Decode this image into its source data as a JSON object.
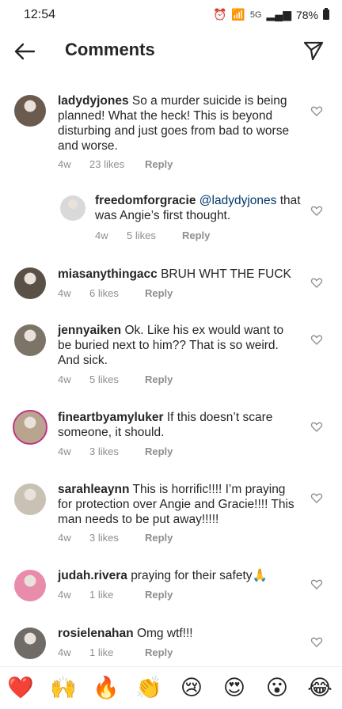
{
  "status": {
    "time": "12:54",
    "network": "5G",
    "battery": "78%"
  },
  "header": {
    "title": "Comments"
  },
  "comments": [
    {
      "user": "ladydyjones",
      "pre": "",
      "mention": "",
      "text": "So a murder suicide is being planned! What the heck! This is beyond disturbing and just goes from bad to worse and worse.",
      "time": "4w",
      "likes": "23 likes",
      "reply": "Reply",
      "avatar_color": "#6b5a4e"
    },
    {
      "user": "freedomforgracie",
      "pre": "",
      "mention": "@ladydyjones",
      "text": "that was Angie’s first thought.",
      "time": "4w",
      "likes": "5 likes",
      "reply": "Reply",
      "avatar_color": "#d9d9d9"
    },
    {
      "user": "miasanythingacc",
      "pre": "",
      "mention": "",
      "text": "BRUH WHT THE FUCK",
      "time": "4w",
      "likes": "6 likes",
      "reply": "Reply",
      "avatar_color": "#5a5146"
    },
    {
      "user": "jennyaiken",
      "pre": "",
      "mention": "",
      "text": "Ok. Like his ex would want to be buried next to him?? That is so weird. And sick.",
      "time": "4w",
      "likes": "5 likes",
      "reply": "Reply",
      "avatar_color": "#7b7467"
    },
    {
      "user": "fineartbyamyluker",
      "pre": "",
      "mention": "",
      "text": "If this doesn’t scare someone, it should.",
      "time": "4w",
      "likes": "3 likes",
      "reply": "Reply",
      "avatar_color": "#b9a58f"
    },
    {
      "user": "sarahleaynn",
      "pre": "",
      "mention": "",
      "text": "This is horrific!!!! I’m praying for protection over Angie and Gracie!!!! This man needs to be put away!!!!!",
      "time": "4w",
      "likes": "3 likes",
      "reply": "Reply",
      "avatar_color": "#c9c1b4"
    },
    {
      "user": "judah.rivera",
      "pre": "",
      "mention": "",
      "text": "praying for their safety🙏",
      "time": "4w",
      "likes": "1 like",
      "reply": "Reply",
      "avatar_color": "#e98cab"
    },
    {
      "user": "rosielenahan",
      "pre": "",
      "mention": "",
      "text": "Omg wtf!!!",
      "time": "4w",
      "likes": "1 like",
      "reply": "Reply",
      "avatar_color": "#6f6b66"
    }
  ],
  "emojis": [
    "❤️",
    "🙌",
    "🔥",
    "👏",
    "😢",
    "😍",
    "😮",
    "😂"
  ]
}
